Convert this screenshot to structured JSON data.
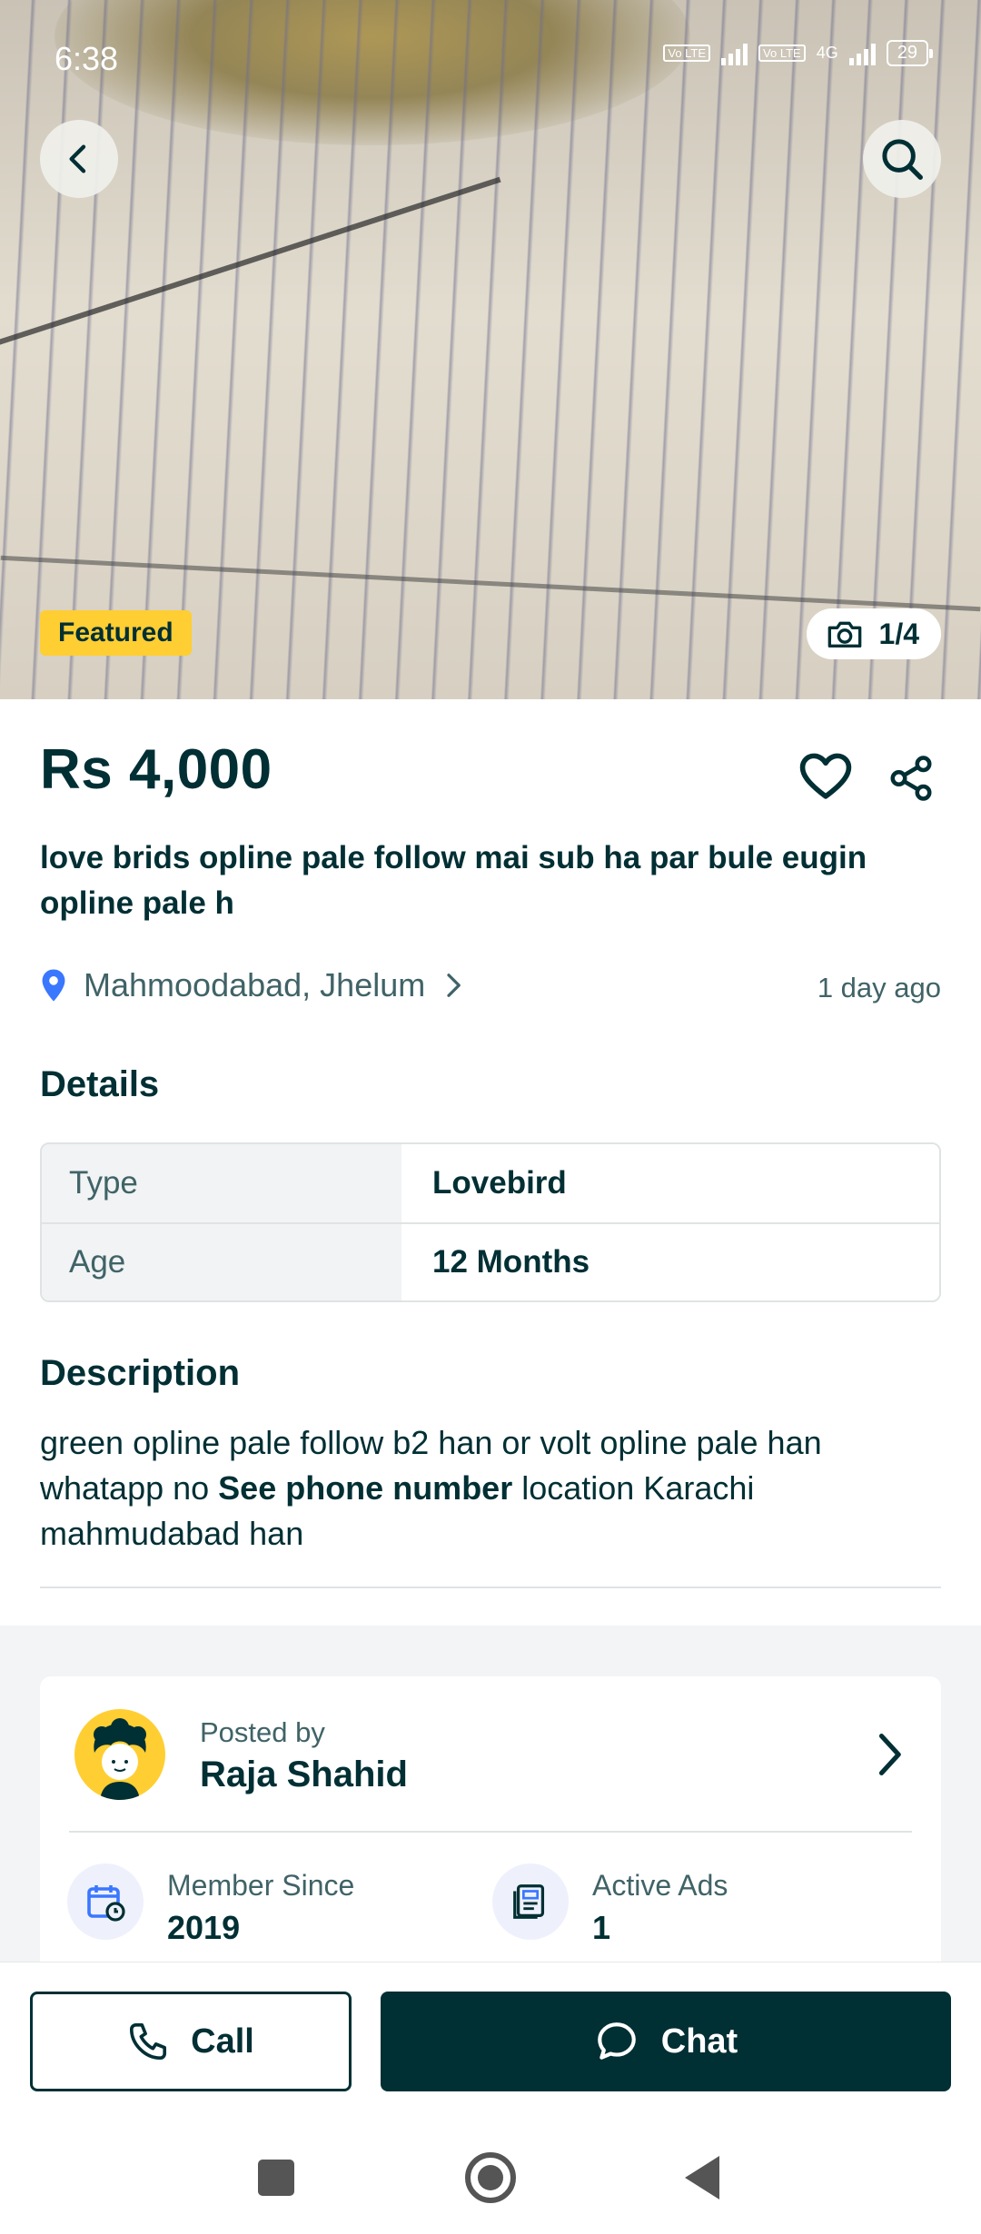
{
  "status_bar": {
    "time": "6:38",
    "network": "4G",
    "lte_label": "Vo LTE",
    "battery": "29"
  },
  "hero": {
    "badge": "Featured",
    "photo_counter": "1/4"
  },
  "listing": {
    "price": "Rs 4,000",
    "title": "love brids opline pale follow mai sub ha  par bule eugin opline pale h",
    "location": "Mahmoodabad, Jhelum",
    "posted_ago": "1 day ago"
  },
  "details": {
    "heading": "Details",
    "rows": [
      {
        "label": "Type",
        "value": "Lovebird"
      },
      {
        "label": "Age",
        "value": "12 Months"
      }
    ]
  },
  "description": {
    "heading": "Description",
    "text_before": "green opline pale follow  b2 han or volt opline  pale han whatapp no ",
    "link": "See phone number",
    "text_after": " location Karachi mahmudabad han"
  },
  "seller": {
    "posted_by_label": "Posted by",
    "name": "Raja Shahid",
    "member_since_label": "Member Since",
    "member_since": "2019",
    "active_ads_label": "Active Ads",
    "active_ads": "1"
  },
  "actions": {
    "call": "Call",
    "chat": "Chat"
  },
  "colors": {
    "primary": "#002f34",
    "featured": "#ffce32",
    "location_pin": "#3a77ff"
  }
}
